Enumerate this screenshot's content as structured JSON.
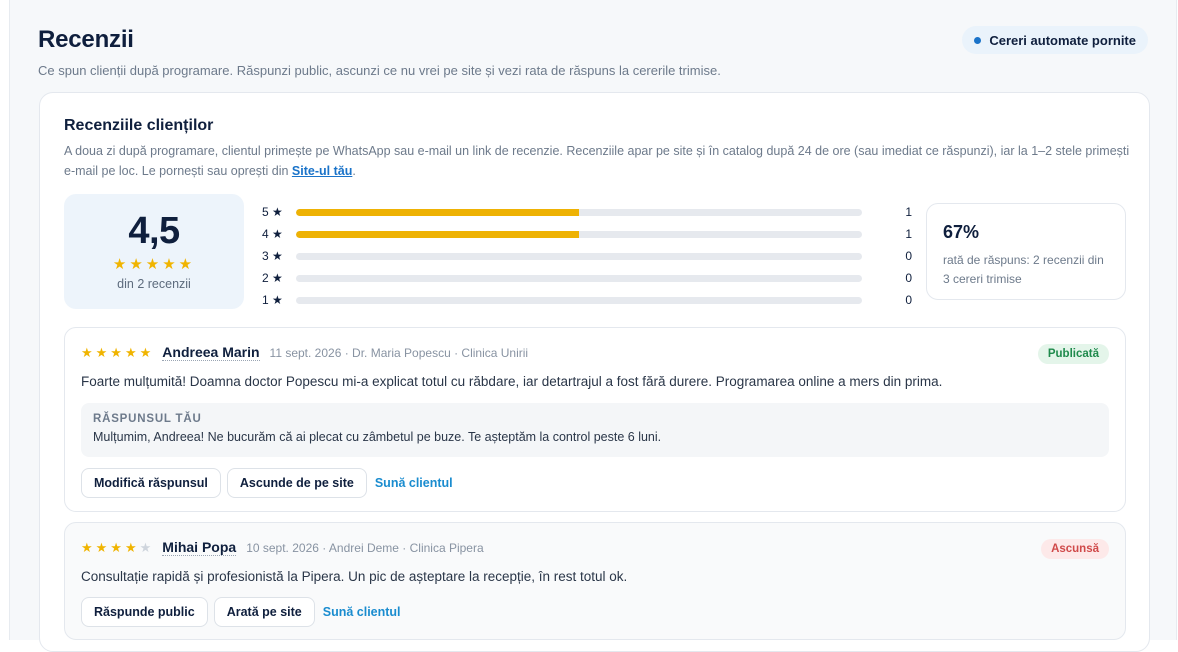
{
  "header": {
    "title": "Recenzii",
    "subtitle": "Ce spun clienții după programare. Răspunzi public, ascunzi ce nu vrei pe site și vezi rata de răspuns la cererile trimise.",
    "status_label": "Cereri automate pornite"
  },
  "card": {
    "title": "Recenziile clienților",
    "description": "A doua zi după programare, clientul primește pe WhatsApp sau e-mail un link de recenzie. Recenziile apar pe site și în catalog după 24 de ore (sau imediat ce răspunzi), iar la 1–2 stele primești e-mail pe loc. Le pornești sau oprești din ",
    "description_link": "Site-ul tău",
    "description_end": "."
  },
  "summary": {
    "average": "4,5",
    "stars": "★★★★★",
    "count_label": "din 2 recenzii",
    "distribution": [
      {
        "label": "5 ★",
        "count": "1",
        "fraction": 0.5
      },
      {
        "label": "4 ★",
        "count": "1",
        "fraction": 0.5
      },
      {
        "label": "3 ★",
        "count": "0",
        "fraction": 0
      },
      {
        "label": "2 ★",
        "count": "0",
        "fraction": 0
      },
      {
        "label": "1 ★",
        "count": "0",
        "fraction": 0
      }
    ],
    "response_rate": "67%",
    "response_text": "rată de răspuns: 2 recenzii din 3 cereri trimise"
  },
  "reviews": [
    {
      "rating": 5,
      "stars_on": "★★★★★",
      "stars_off": "",
      "name": "Andreea Marin",
      "meta": "11 sept. 2026 · Dr. Maria Popescu · Clinica Unirii",
      "status": "Publicată",
      "text": "Foarte mulțumită! Doamna doctor Popescu mi-a explicat totul cu răbdare, iar detartrajul a fost fără durere. Programarea online a mers din prima.",
      "reply_label": "RĂSPUNSUL TĂU",
      "reply_text": "Mulțumim, Andreea! Ne bucurăm că ai plecat cu zâmbetul pe buze. Te așteptăm la control peste 6 luni.",
      "btn_primary": "Modifică răspunsul",
      "btn_secondary": "Ascunde de pe site",
      "link": "Sună clientul"
    },
    {
      "rating": 4,
      "stars_on": "★★★★",
      "stars_off": "★",
      "name": "Mihai Popa",
      "meta": "10 sept. 2026 · Andrei Deme · Clinica Pipera",
      "status": "Ascunsă",
      "text": "Consultație rapidă și profesionistă la Pipera. Un pic de așteptare la recepție, în rest totul ok.",
      "btn_primary": "Răspunde public",
      "btn_secondary": "Arată pe site",
      "link": "Sună clientul"
    }
  ],
  "colors": {
    "accent": "#1a73c9",
    "star": "#f0b400",
    "bar_fill": "#eeb204",
    "published": "#1f8a4c",
    "hidden": "#d04a4a"
  }
}
